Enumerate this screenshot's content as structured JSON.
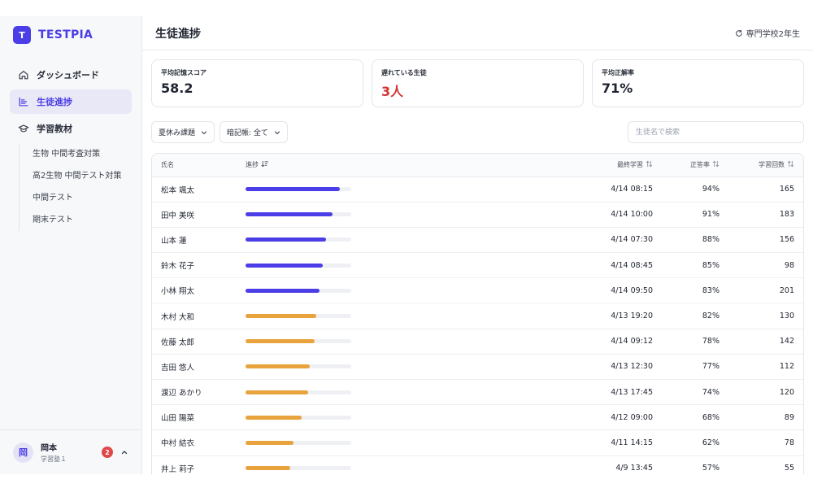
{
  "brand": {
    "logo_letter": "T",
    "name": "TESTPIA",
    "accent": "#4b3ee6"
  },
  "sidebar": {
    "items": [
      {
        "label": "ダッシュボード",
        "icon": "home-icon",
        "active": false
      },
      {
        "label": "生徒進捗",
        "icon": "chart-icon",
        "active": true
      },
      {
        "label": "学習教材",
        "icon": "graduation-cap-icon",
        "active": false
      }
    ],
    "materials": [
      "生物 中間考査対策",
      "高2生物 中間テスト対策",
      "中間テスト",
      "期末テスト"
    ]
  },
  "user": {
    "avatar": "岡",
    "name": "岡本",
    "org": "学習塾１",
    "notifications": "2"
  },
  "header": {
    "title": "生徒進捗",
    "school": "専門学校2年生"
  },
  "stats": [
    {
      "label": "平均記憶スコア",
      "value": "58.2",
      "danger": false
    },
    {
      "label": "遅れている生徒",
      "value": "3人",
      "danger": true
    },
    {
      "label": "平均正解率",
      "value": "71%",
      "danger": false
    }
  ],
  "filters": {
    "assignment": "夏休み課題",
    "wordbook": "暗記帳: 全て",
    "search_placeholder": "生徒名で検索"
  },
  "table": {
    "headers": {
      "name": "氏名",
      "progress": "進捗",
      "last": "最終学習",
      "rate": "正答率",
      "count": "学習回数"
    },
    "colors": {
      "high": "#4b3ee6",
      "mid": "#e8a33c"
    },
    "rows": [
      {
        "name": "松本 颯太",
        "progress": 0.89,
        "tier": "high",
        "last": "4/14 08:15",
        "rate": "94%",
        "count": "165"
      },
      {
        "name": "田中 美咲",
        "progress": 0.82,
        "tier": "high",
        "last": "4/14 10:00",
        "rate": "91%",
        "count": "183"
      },
      {
        "name": "山本 蓮",
        "progress": 0.76,
        "tier": "high",
        "last": "4/14 07:30",
        "rate": "88%",
        "count": "156"
      },
      {
        "name": "鈴木 花子",
        "progress": 0.73,
        "tier": "high",
        "last": "4/14 08:45",
        "rate": "85%",
        "count": "98"
      },
      {
        "name": "小林 翔太",
        "progress": 0.7,
        "tier": "high",
        "last": "4/14 09:50",
        "rate": "83%",
        "count": "201"
      },
      {
        "name": "木村 大和",
        "progress": 0.67,
        "tier": "mid",
        "last": "4/13 19:20",
        "rate": "82%",
        "count": "130"
      },
      {
        "name": "佐藤 太郎",
        "progress": 0.65,
        "tier": "mid",
        "last": "4/14 09:12",
        "rate": "78%",
        "count": "142"
      },
      {
        "name": "吉田 悠人",
        "progress": 0.61,
        "tier": "mid",
        "last": "4/13 12:30",
        "rate": "77%",
        "count": "112"
      },
      {
        "name": "渡辺 あかり",
        "progress": 0.59,
        "tier": "mid",
        "last": "4/13 17:45",
        "rate": "74%",
        "count": "120"
      },
      {
        "name": "山田 陽菜",
        "progress": 0.53,
        "tier": "mid",
        "last": "4/12 09:00",
        "rate": "68%",
        "count": "89"
      },
      {
        "name": "中村 結衣",
        "progress": 0.45,
        "tier": "mid",
        "last": "4/11 14:15",
        "rate": "62%",
        "count": "78"
      },
      {
        "name": "井上 莉子",
        "progress": 0.42,
        "tier": "mid",
        "last": "4/9 13:45",
        "rate": "57%",
        "count": "55"
      }
    ]
  }
}
